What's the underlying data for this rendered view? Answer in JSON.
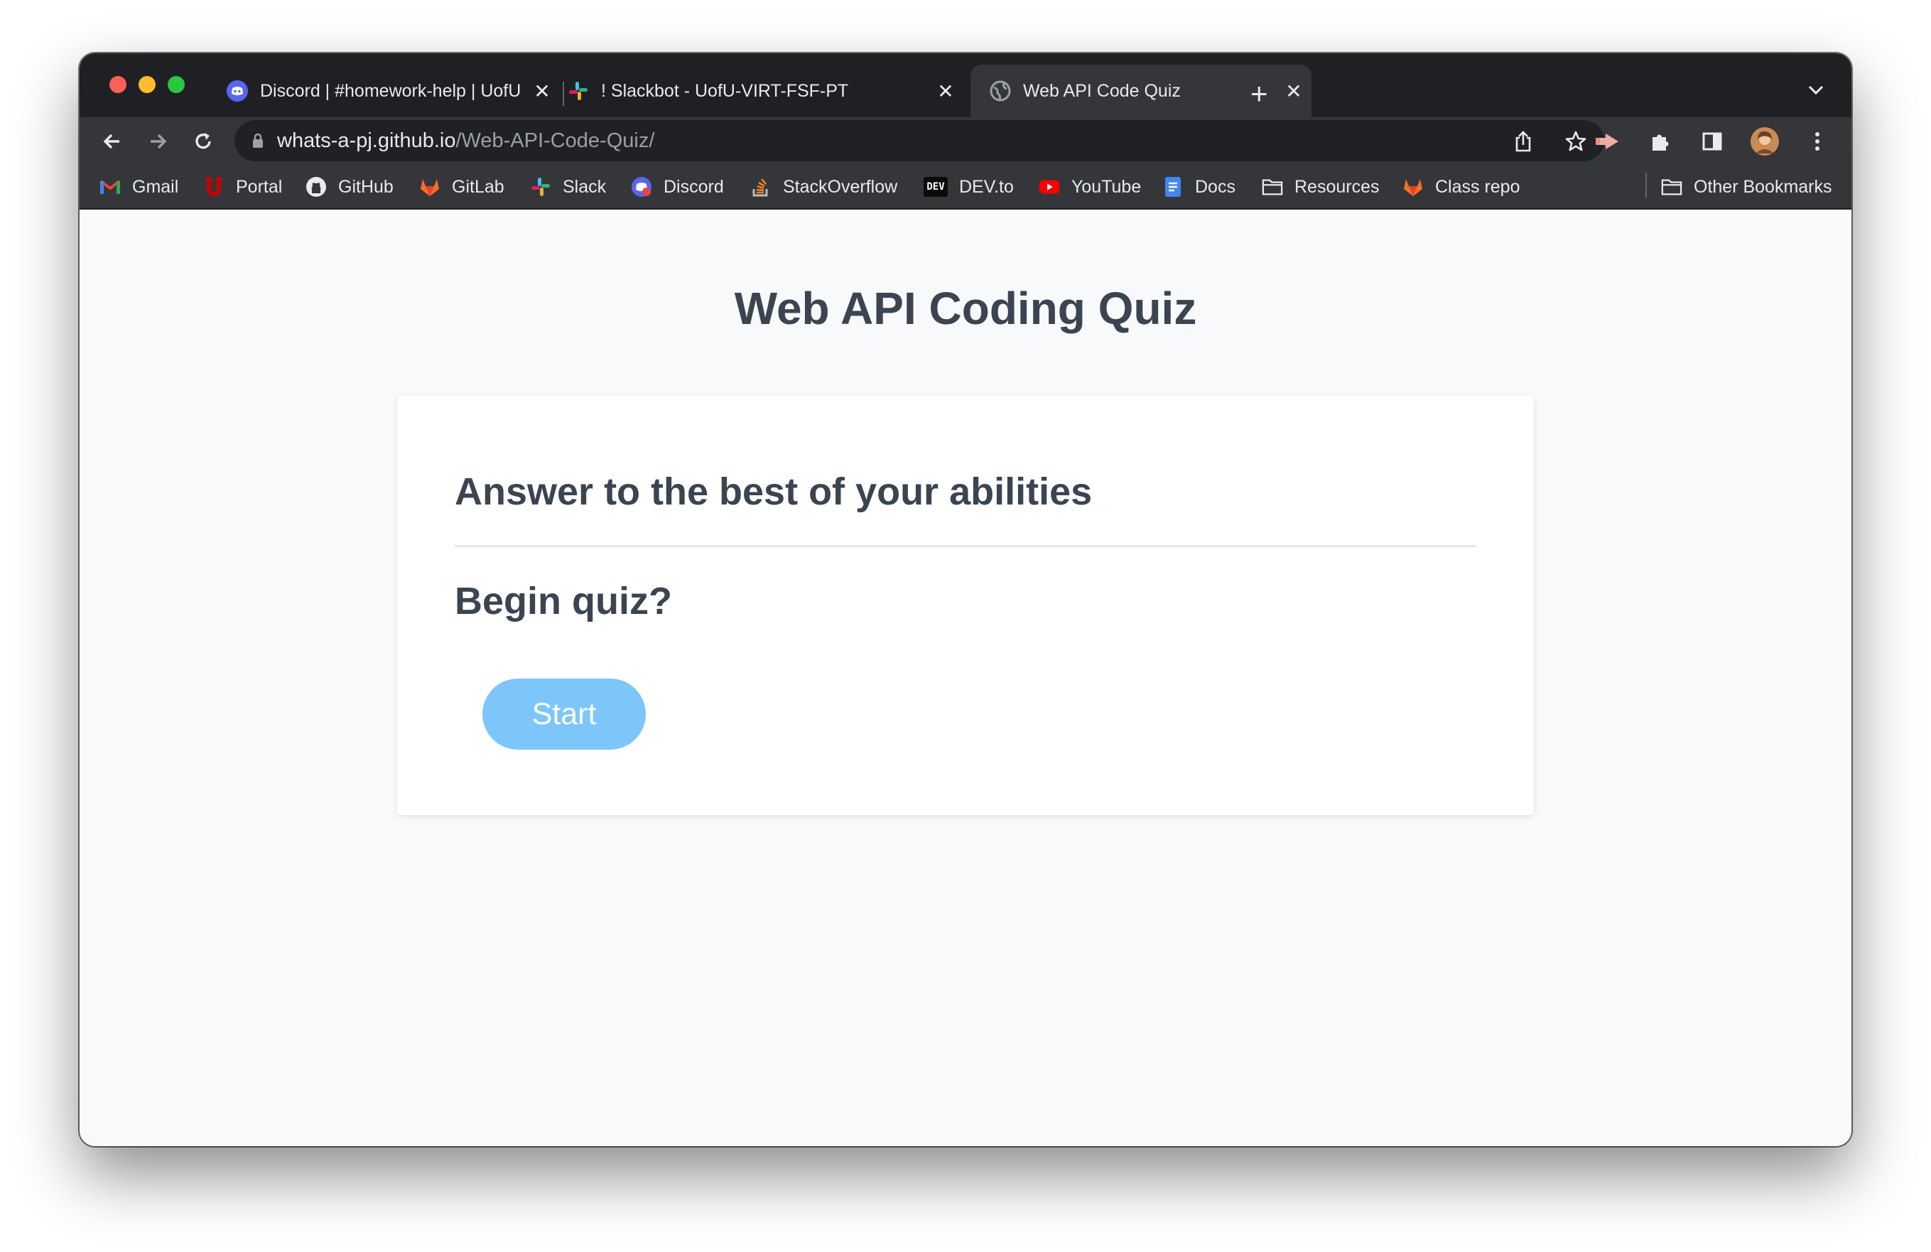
{
  "browser": {
    "tabs": [
      {
        "title": "Discord | #homework-help | UofU",
        "icon": "discord-icon",
        "active": false
      },
      {
        "title": "! Slackbot - UofU-VIRT-FSF-PT",
        "icon": "slack-icon",
        "active": false
      },
      {
        "title": "Web API Code Quiz",
        "icon": "globe-icon",
        "active": true
      }
    ],
    "close_glyph": "✕",
    "new_tab_glyph": "+",
    "url_host": "whats-a-pj.github.io",
    "url_path": "/Web-API-Code-Quiz/",
    "bookmarks": [
      {
        "label": "Gmail",
        "icon": "gmail-icon"
      },
      {
        "label": "Portal",
        "icon": "portal-icon"
      },
      {
        "label": "GitHub",
        "icon": "github-icon"
      },
      {
        "label": "GitLab",
        "icon": "gitlab-icon"
      },
      {
        "label": "Slack",
        "icon": "slack-icon"
      },
      {
        "label": "Discord",
        "icon": "discord-icon"
      },
      {
        "label": "StackOverflow",
        "icon": "stackoverflow-icon"
      },
      {
        "label": "DEV.to",
        "icon": "devto-icon"
      },
      {
        "label": "YouTube",
        "icon": "youtube-icon"
      },
      {
        "label": "Docs",
        "icon": "docs-icon"
      },
      {
        "label": "Resources",
        "icon": "folder-icon"
      },
      {
        "label": "Class repo",
        "icon": "gitlab-icon"
      }
    ],
    "other_bookmarks": "Other Bookmarks",
    "devto_badge": "DEV"
  },
  "page": {
    "title": "Web API Coding Quiz",
    "card": {
      "heading": "Answer to the best of your abilities",
      "prompt": "Begin quiz?",
      "start_label": "Start"
    }
  },
  "colors": {
    "button": "#7dc6fa",
    "heading": "#3a4551",
    "page_bg": "#f8f9fb",
    "chrome_dark": "#1f2023",
    "chrome_toolbar": "#35363a"
  }
}
